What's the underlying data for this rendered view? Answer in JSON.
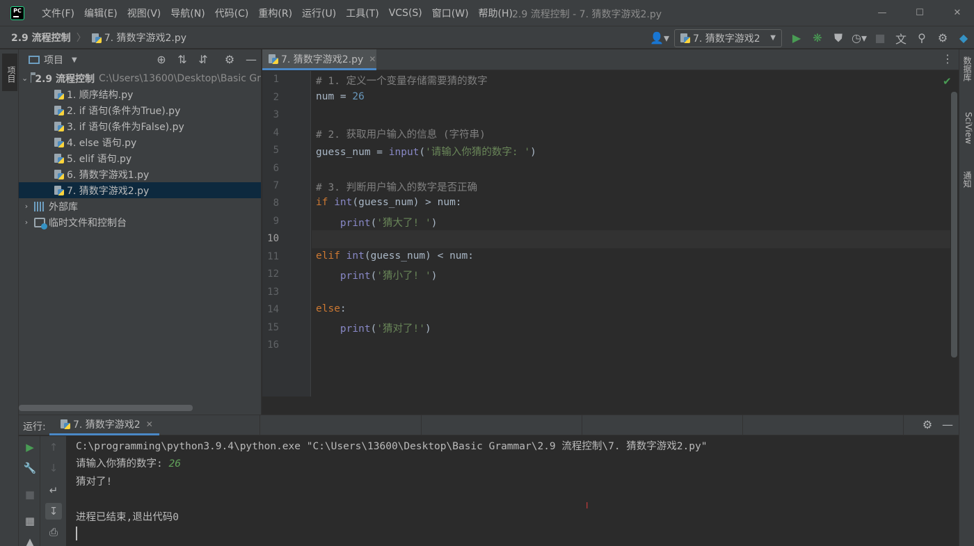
{
  "titlebar": {
    "menu": [
      "文件(F)",
      "编辑(E)",
      "视图(V)",
      "导航(N)",
      "代码(C)",
      "重构(R)",
      "运行(U)",
      "工具(T)",
      "VCS(S)",
      "窗口(W)",
      "帮助(H)"
    ],
    "window_title": "2.9 流程控制 - 7. 猜数字游戏2.py",
    "controls": {
      "minimize": "—",
      "maximize": "☐",
      "close": "✕"
    }
  },
  "navbar": {
    "root": "2.9 流程控制",
    "separator": "〉",
    "file": "7. 猜数字游戏2.py",
    "run_config": "7. 猜数字游戏2"
  },
  "left_strip": {
    "project_tab": "项目"
  },
  "right_strip": {
    "database_tab": "数据库",
    "sciview_tab": "SciView",
    "notifications_tab": "通知"
  },
  "project": {
    "header_title": "项目",
    "root_name": "2.9 流程控制",
    "root_path": "C:\\Users\\13600\\Desktop\\Basic Gr",
    "files": [
      "1. 顺序结构.py",
      "2. if 语句(条件为True).py",
      "3. if 语句(条件为False).py",
      "4. else 语句.py",
      "5. elif 语句.py",
      "6. 猜数字游戏1.py",
      "7. 猜数字游戏2.py"
    ],
    "selected_file_index": 6,
    "external_libs": "外部库",
    "scratches": "临时文件和控制台"
  },
  "editor": {
    "tab_label": "7. 猜数字游戏2.py",
    "current_line": 10,
    "line_numbers": [
      "1",
      "2",
      "3",
      "4",
      "5",
      "6",
      "7",
      "8",
      "9",
      "10",
      "11",
      "12",
      "13",
      "14",
      "15",
      "16"
    ],
    "lines": {
      "l1": "# 1. 定义一个变量存储需要猜的数字",
      "l2_a": "num = ",
      "l2_num": "26",
      "l4": "# 2. 获取用户输入的信息 (字符串)",
      "l5_a": "guess_num = ",
      "l5_fn": "input",
      "l5_p": "(",
      "l5_str": "'请输入你猜的数字: '",
      "l5_e": ")",
      "l7": "# 3. 判断用户输入的数字是否正确",
      "l8_kw": "if ",
      "l8_fn": "int",
      "l8_rest": "(guess_num) > num:",
      "l9_ind": "    ",
      "l9_fn": "print",
      "l9_p": "(",
      "l9_str": "'猜大了! '",
      "l9_e": ")",
      "l11_kw": "elif ",
      "l11_fn": "int",
      "l11_rest": "(guess_num) < num:",
      "l12_ind": "    ",
      "l12_fn": "print",
      "l12_p": "(",
      "l12_str": "'猜小了! '",
      "l12_e": ")",
      "l14_kw": "else",
      "l14_rest": ":",
      "l15_ind": "    ",
      "l15_fn": "print",
      "l15_p": "(",
      "l15_str": "'猜对了!'",
      "l15_e": ")"
    }
  },
  "run": {
    "label": "运行:",
    "tab_label": "7. 猜数字游戏2",
    "console": {
      "command": "C:\\programming\\python3.9.4\\python.exe \"C:\\Users\\13600\\Desktop\\Basic Grammar\\2.9 流程控制\\7. 猜数字游戏2.py\"",
      "prompt": "请输入你猜的数字: ",
      "user_input": "26",
      "result": "猜对了!",
      "exit": "进程已结束,退出代码0"
    }
  },
  "colors": {
    "accent": "#4a88c7",
    "run_green": "#499c54",
    "keyword": "#cc7832",
    "string": "#6a8759",
    "number": "#6897bb",
    "comment": "#808080"
  }
}
